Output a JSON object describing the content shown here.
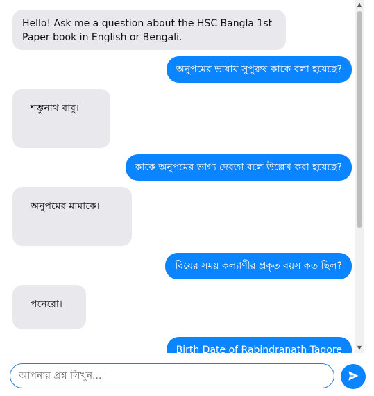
{
  "messages": [
    {
      "role": "bot",
      "text": "Hello! Ask me a question about the HSC Bangla 1st Paper book in English or Bengali."
    },
    {
      "role": "user",
      "text": "অনুপমের ভাষায় সুপুরুষ কাকে বলা হয়েছে?"
    },
    {
      "role": "bot",
      "text": "শম্ভুনাথ বাবু।"
    },
    {
      "role": "user",
      "text": "কাকে অনুপমের ভাগ্য দেবতা বলে উল্লেখ করা হয়েছে?"
    },
    {
      "role": "bot",
      "text": "অনুপমের মামাকে।"
    },
    {
      "role": "user",
      "text": "বিয়ের সময় কল্যাণীর প্রকৃত বয়স কত ছিল?"
    },
    {
      "role": "bot",
      "text": "পনেরো।"
    },
    {
      "role": "user",
      "text": "Birth Date of Rabindranath Tagore"
    }
  ],
  "input": {
    "placeholder": "আপনার প্রশ্ন লিখুন..."
  },
  "send_button": {
    "icon": "send-icon"
  },
  "colors": {
    "user_bubble": "#0a84ff",
    "bot_bubble": "#e9e9ed",
    "input_border": "#2b7cd3"
  }
}
